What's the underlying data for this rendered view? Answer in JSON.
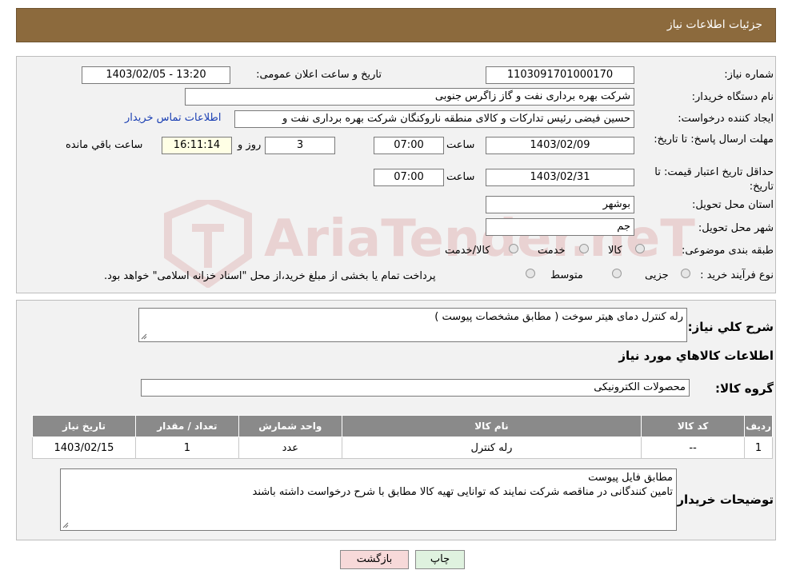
{
  "header": {
    "title": "جزئیات اطلاعات نیاز"
  },
  "watermark_text": "AriaTender.neT",
  "form": {
    "need_number_label": "شماره نیاز:",
    "need_number": "1103091701000170",
    "announce_label": "تاریخ و ساعت اعلان عمومی:",
    "announce_value": "1403/02/05 - 13:20",
    "buyer_label": "نام دستگاه خریدار:",
    "buyer_value": "شرکت بهره برداری نفت و گاز زاگرس جنوبی",
    "creator_label": "ایجاد کننده درخواست:",
    "creator_value": "حسین فیضی رئیس تدارکات و کالای منطقه ناروکنگان شرکت بهره برداری نفت و",
    "contact_link": "اطلاعات تماس خریدار",
    "deadline_label": "مهلت ارسال پاسخ: تا تاریخ:",
    "deadline_date": "1403/02/09",
    "time_label": "ساعت",
    "deadline_time": "07:00",
    "days_value": "3",
    "days_label": "روز و",
    "remaining_time": "16:11:14",
    "remaining_label": "ساعت باقي مانده",
    "validity_label": "حداقل تاریخ اعتبار قیمت: تا تاریخ:",
    "validity_date": "1403/02/31",
    "validity_time": "07:00",
    "province_label": "استان محل تحویل:",
    "province_value": "بوشهر",
    "city_label": "شهر محل تحویل:",
    "city_value": "جم",
    "category_label": "طبقه بندی موضوعی:",
    "category_options": [
      "کالا",
      "خدمت",
      "کالا/خدمت"
    ],
    "process_label": "نوع فرآیند خرید :",
    "process_options": [
      "جزیی",
      "متوسط"
    ],
    "payment_note": "پرداخت تمام یا بخشی از مبلغ خرید،از محل \"اسناد خزانه اسلامی\" خواهد بود."
  },
  "details": {
    "desc_label": "شرح کلي نياز:",
    "desc_value": "رله کنترل دمای هیتر سوخت ( مطابق مشخصات پیوست )",
    "goods_title": "اطلاعات کالاهاي مورد نياز",
    "group_label": "گروه کالا:",
    "group_value": "محصولات الکترونیکی",
    "table": {
      "headers": [
        "رديف",
        "کد کالا",
        "نام کالا",
        "واحد شمارش",
        "تعداد / مقدار",
        "تاريخ نياز"
      ],
      "rows": [
        [
          "1",
          "--",
          "رله کنترل",
          "عدد",
          "1",
          "1403/02/15"
        ]
      ]
    },
    "buyer_notes_label": "توضیحات خریدار:",
    "buyer_notes_line1": "مطابق فایل پیوست",
    "buyer_notes_line2": "تامین کنندگانی در مناقصه شرکت نمایند که توانایی تهیه کالا مطابق با شرح درخواست داشته باشند"
  },
  "buttons": {
    "print": "چاپ",
    "back": "بازگشت"
  },
  "colors": {
    "header_bg": "#8c6a3d",
    "table_header_bg": "#8a8a8a",
    "back_btn_bg": "#f7d9d9",
    "print_btn_bg": "#dff2df"
  }
}
